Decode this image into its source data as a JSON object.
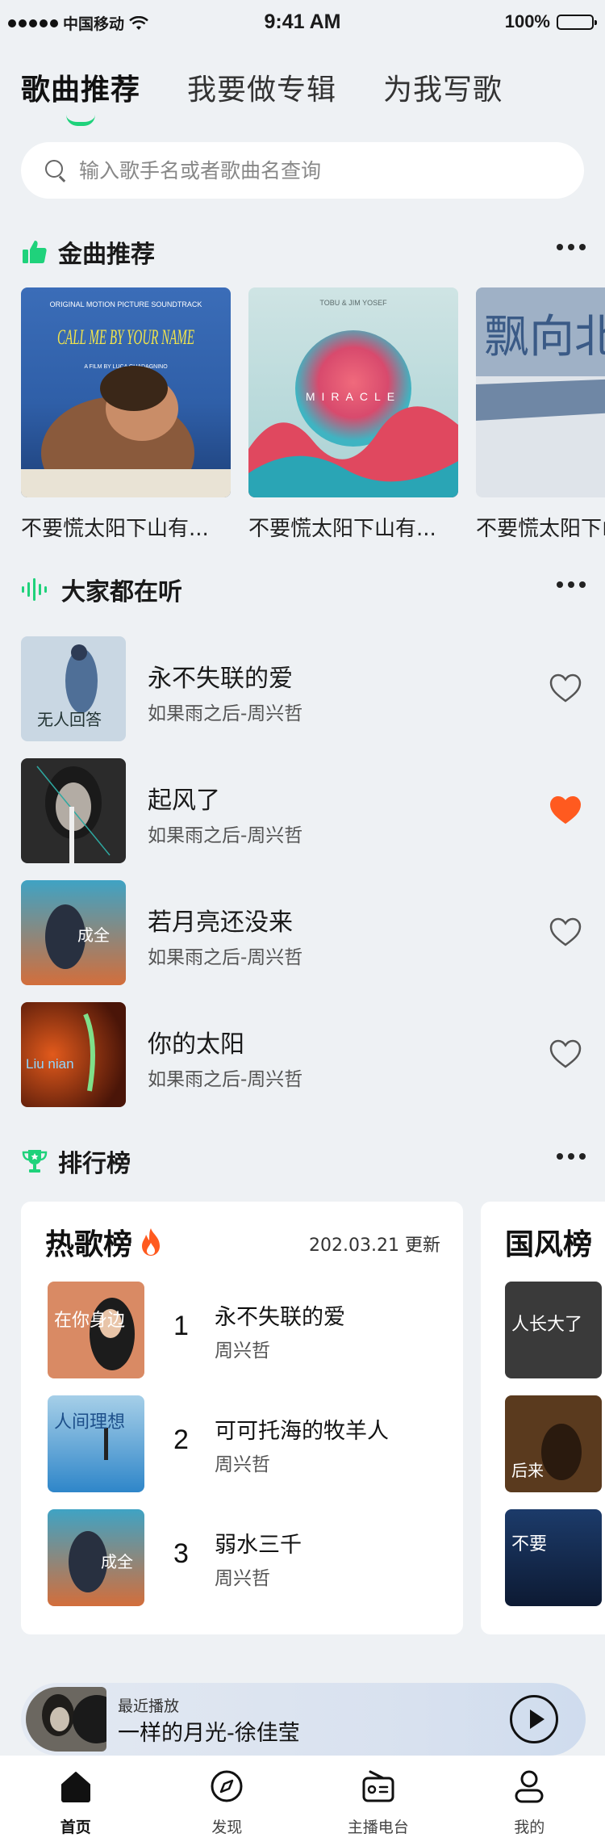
{
  "status_bar": {
    "carrier": "中国移动",
    "time": "9:41 AM",
    "battery": "100%"
  },
  "top_tabs": [
    {
      "label": "歌曲推荐",
      "active": true
    },
    {
      "label": "我要做专辑",
      "active": false
    },
    {
      "label": "为我写歌",
      "active": false
    }
  ],
  "search": {
    "placeholder": "输入歌手名或者歌曲名查询"
  },
  "sections": {
    "golden": {
      "title": "金曲推荐",
      "icon": "thumbs-up-icon"
    },
    "listening": {
      "title": "大家都在听",
      "icon": "sound-wave-icon"
    },
    "charts": {
      "title": "排行榜",
      "icon": "trophy-icon"
    }
  },
  "albums": [
    {
      "title": "不要慌太阳下山有...",
      "cover_text": "ORIGINAL MOTION PICTURE SOUNDTRACK",
      "cover_title": "CALL ME BY YOUR NAME",
      "cover_sub": "A FILM BY LUCA GUADAGNINO"
    },
    {
      "title": "不要慌太阳下山有...",
      "cover_text": "TOBU & JIM YOSEF",
      "cover_title": "MIRACLE"
    },
    {
      "title": "不要慌太阳下山有...",
      "cover_title": "飘向北方"
    }
  ],
  "songs": [
    {
      "name": "永不失联的爱",
      "artist": "如果雨之后-周兴哲",
      "liked": false,
      "cover_text": "无人回答"
    },
    {
      "name": "起风了",
      "artist": "如果雨之后-周兴哲",
      "liked": true
    },
    {
      "name": "若月亮还没来",
      "artist": "如果雨之后-周兴哲",
      "liked": false,
      "cover_text": "成全"
    },
    {
      "name": "你的太阳",
      "artist": "如果雨之后-周兴哲",
      "liked": false,
      "cover_text": "Liu nian"
    }
  ],
  "charts": {
    "hot": {
      "title": "热歌榜",
      "date": "202.03.21 更新",
      "items": [
        {
          "rank": "1",
          "name": "永不失联的爱",
          "artist": "周兴哲",
          "cover_text": "在你身边"
        },
        {
          "rank": "2",
          "name": "可可托海的牧羊人",
          "artist": "周兴哲",
          "cover_text": "人间理想"
        },
        {
          "rank": "3",
          "name": "弱水三千",
          "artist": "周兴哲",
          "cover_text": "成全"
        }
      ]
    },
    "guofeng": {
      "title": "国风榜",
      "covers": [
        "人长大了",
        "后来",
        "不要"
      ]
    }
  },
  "mini_player": {
    "label": "最近播放",
    "song": "一样的月光-徐佳莹"
  },
  "tabbar": [
    {
      "label": "首页",
      "icon": "home-icon",
      "active": true
    },
    {
      "label": "发现",
      "icon": "compass-icon",
      "active": false
    },
    {
      "label": "主播电台",
      "icon": "radio-icon",
      "active": false
    },
    {
      "label": "我的",
      "icon": "user-icon",
      "active": false
    }
  ],
  "colors": {
    "accent_green": "#1fd27b",
    "heart_orange": "#ff5a1f",
    "background": "#eef1f4"
  }
}
